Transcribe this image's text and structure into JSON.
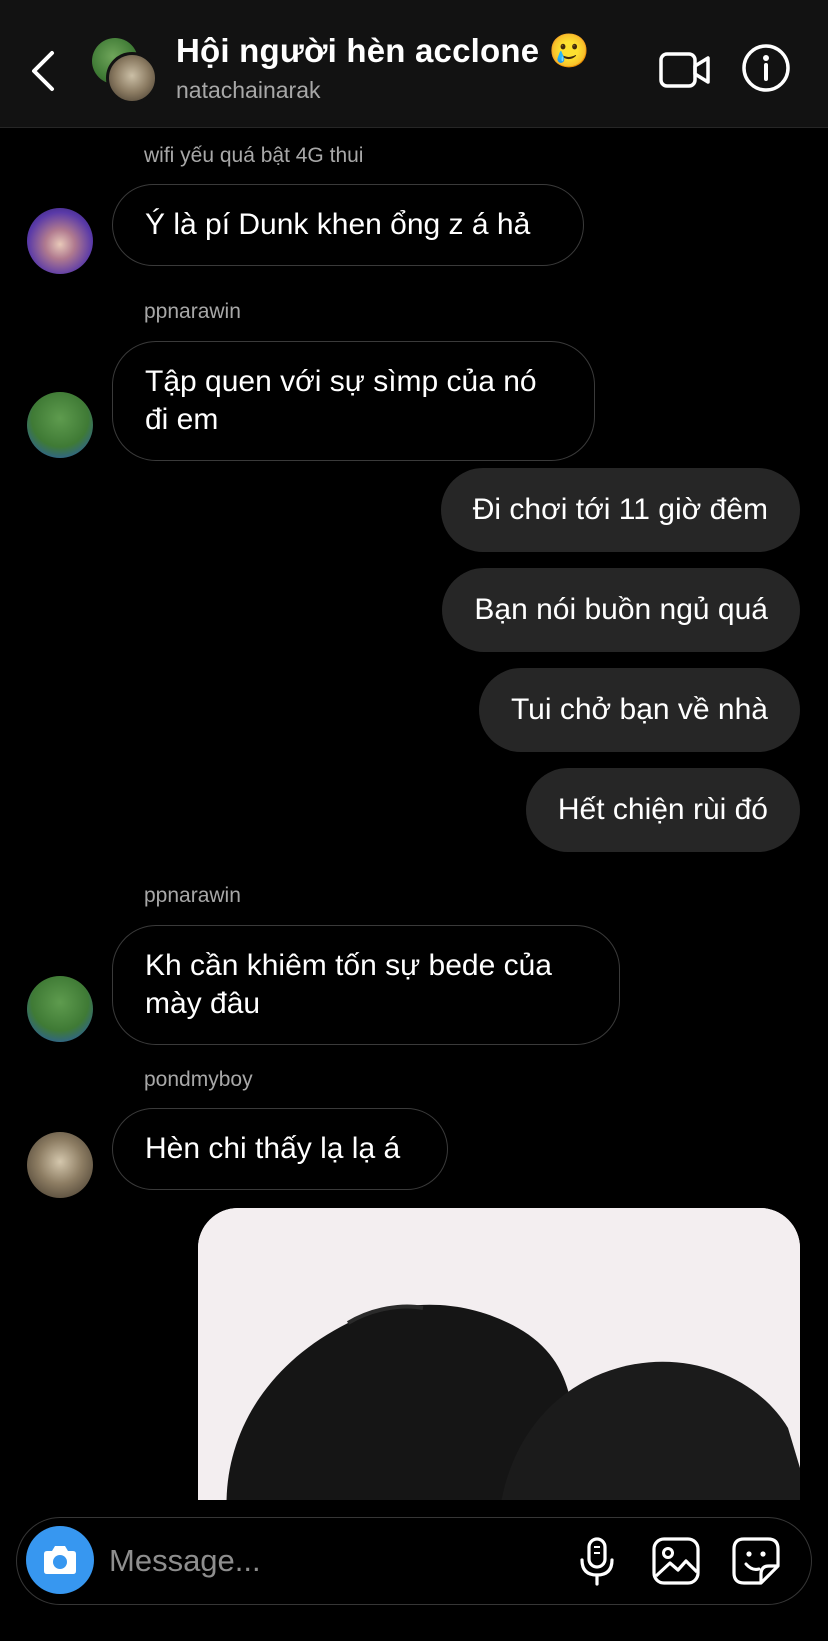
{
  "header": {
    "title": "Hội người hèn acclone 🥲",
    "subtitle": "natachainarak"
  },
  "messages": [
    {
      "sender": "wifi yếu quá bật 4G thui",
      "text": "Ý là pí Dunk khen ổng z á hả",
      "direction": "incoming"
    },
    {
      "sender": "ppnarawin",
      "text": "Tập quen với sự sìmp của nó đi em",
      "direction": "incoming"
    },
    {
      "text": "Đi chơi tới 11 giờ đêm",
      "direction": "outgoing"
    },
    {
      "text": "Bạn nói buồn ngủ quá",
      "direction": "outgoing"
    },
    {
      "text": "Tui chở bạn về nhà",
      "direction": "outgoing"
    },
    {
      "text": "Hết chiện rùi đó",
      "direction": "outgoing"
    },
    {
      "sender": "ppnarawin",
      "text": "Kh cần khiêm tốn sự bede của mày đâu",
      "direction": "incoming"
    },
    {
      "sender": "pondmyboy",
      "text": "Hèn chi thấy lạ lạ á",
      "direction": "incoming"
    }
  ],
  "composer": {
    "placeholder": "Message..."
  },
  "colors": {
    "background": "#000000",
    "header": "#121212",
    "outgoing_bubble": "#262626",
    "incoming_border": "#3a3a3a",
    "camera_button": "#3797f0",
    "secondary_text": "#a8a8a8"
  },
  "icons": [
    "chevron-left-icon",
    "video-camera-icon",
    "info-icon",
    "camera-icon",
    "microphone-icon",
    "gallery-icon",
    "sticker-icon"
  ]
}
